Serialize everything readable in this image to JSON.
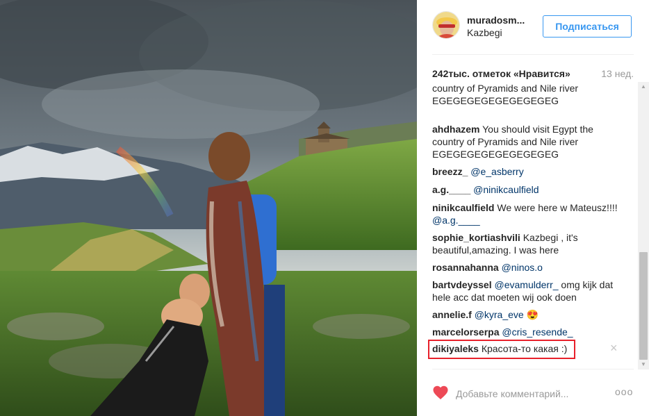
{
  "post": {
    "photo_alt": "Gergeti Trinity Church",
    "author": {
      "username": "muradosm...",
      "location": "Kazbegi"
    },
    "follow_label": "Подписаться",
    "likes": "242тыс. отметок «Нравится»",
    "time_ago": "13 нед.",
    "comments": [
      {
        "user": "",
        "text": "country of Pyramids and Nile river EGEGEGEGEGEGEGEGEG",
        "partial": true
      },
      {
        "user": "ahdhazem",
        "text": "You should visit Egypt the country of Pyramids and Nile river EGEGEGEGEGEGEGEGEG"
      },
      {
        "user": "breezz_",
        "mention": "@e_asberry"
      },
      {
        "user": "a.g.____",
        "mention": "@ninikcaulfield"
      },
      {
        "user": "ninikcaulfield",
        "text": "We were here w Mateusz!!!!",
        "mention": "@a.g.____"
      },
      {
        "user": "sophie_kortiashvili",
        "text": "Kazbegi , it's beautiful,amazing. I was here"
      },
      {
        "user": "rosannahanna",
        "mention": "@ninos.o"
      },
      {
        "user": "bartvdeyssel",
        "mention": "@evamulderr_",
        "text": "omg kijk dat hele acc dat moeten wij ook doen"
      },
      {
        "user": "annelie.f",
        "mention": "@kyra_eve",
        "emoji": "😍"
      },
      {
        "user": "marcelorserpa",
        "mention": "@cris_resende_"
      },
      {
        "user": "dikiyaleks",
        "text": "Красота-то какая :)",
        "highlighted": true
      }
    ],
    "delete_icon": "×",
    "comment_placeholder": "Добавьте комментарий...",
    "more_icon": "ooo"
  },
  "colors": {
    "accent": "#3897f0",
    "highlight": "#e8202a",
    "heart": "#ed4956",
    "mention": "#003569"
  }
}
